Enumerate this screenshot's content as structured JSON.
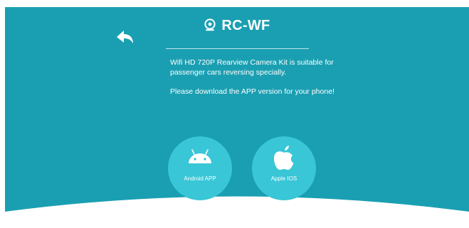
{
  "header": {
    "title": "RC-WF",
    "icons": {
      "back": "back-arrow-icon",
      "camera": "webcam-icon"
    }
  },
  "description": {
    "line1": "Wifi HD 720P Rearview Camera Kit  is suitable for passenger cars reversing specially.",
    "line2": "Please download the APP version for your phone!"
  },
  "downloads": {
    "android": {
      "label": "Android APP",
      "icon": "android-icon"
    },
    "apple": {
      "label": "Apple IOS",
      "icon": "apple-icon"
    }
  },
  "colors": {
    "background": "#1a9fb2",
    "button": "#39c6d6",
    "text": "#ffffff"
  }
}
